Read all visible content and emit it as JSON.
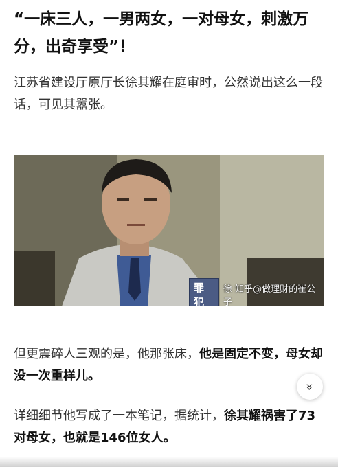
{
  "article": {
    "title": "“一床三人，一男两女，一对母女，刺激万分，出奇享受”！",
    "para1": "江苏省建设厅原厅长徐其耀在庭审时，公然说出这么一段话，可见其嚣张。",
    "para2_normal": "但更震碎人三观的是，他那张床，",
    "para2_bold": "他是固定不变，母女却没一次重样儿。",
    "para3_normal": "详细细节他写成了一本笔记，据统计，",
    "para3_bold": "徐其耀祸害了73对母女，也就是146位女人。"
  },
  "photo": {
    "caption_tag": "罪犯",
    "caption_text": "徐 知乎@做理财的崔公子"
  },
  "controls": {
    "scroll_icon": "double-chevron-down-icon",
    "scroll_glyph": "»"
  }
}
